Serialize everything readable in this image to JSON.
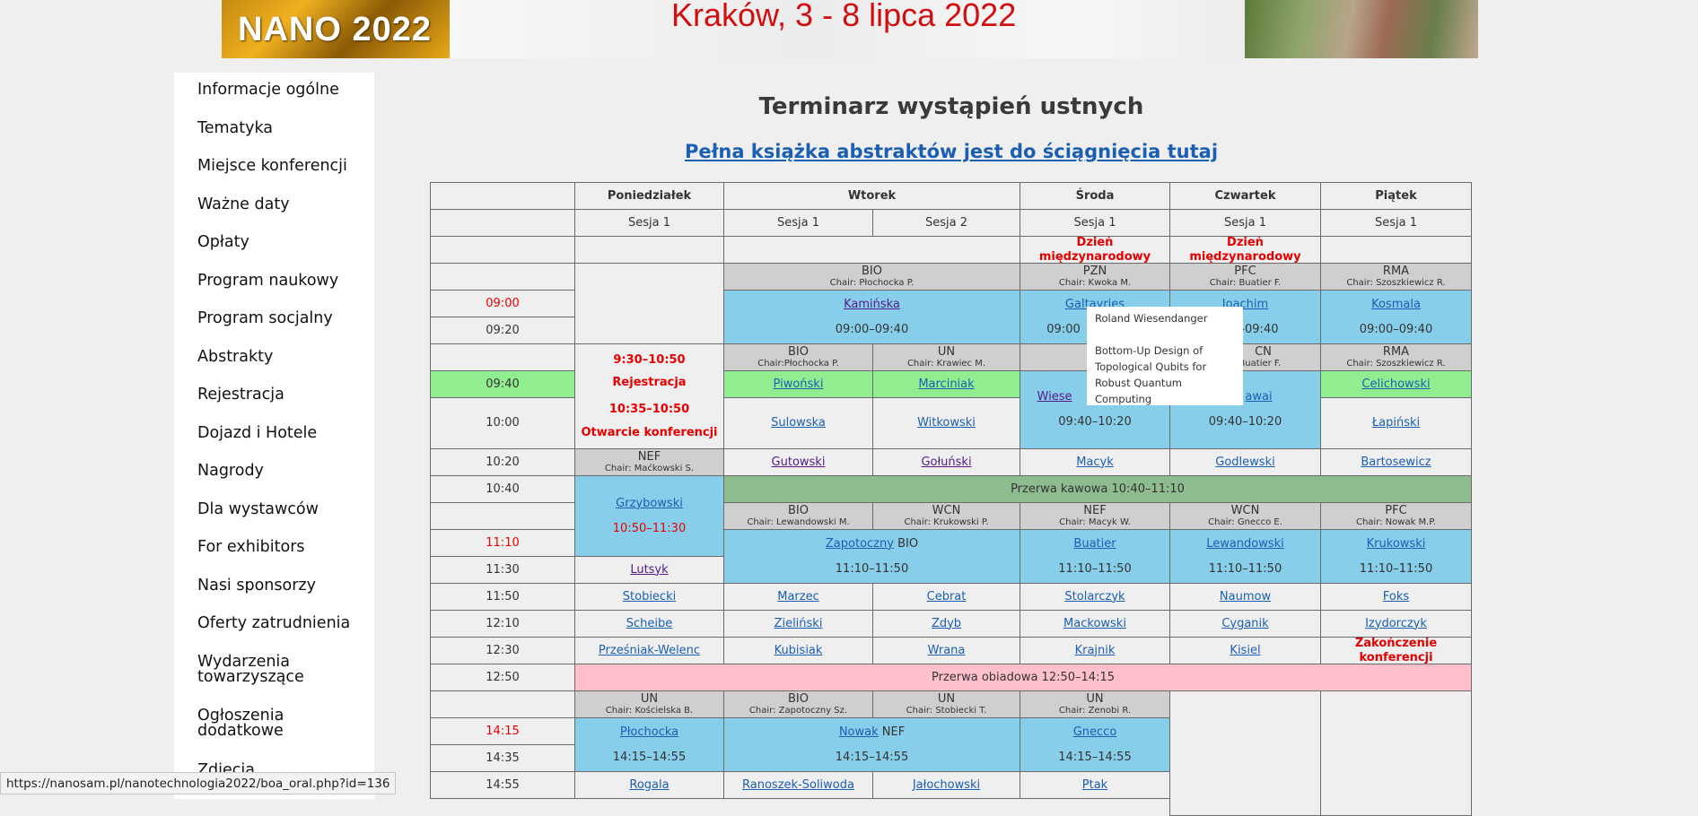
{
  "banner": {
    "logo_text": "NANO 2022",
    "subtitle": "Kraków, 3 - 8 lipca 2022"
  },
  "sidebar": {
    "items": [
      {
        "label": "Informacje ogólne"
      },
      {
        "label": "Tematyka"
      },
      {
        "label": "Miejsce konferencji"
      },
      {
        "label": "Ważne daty"
      },
      {
        "label": "Opłaty"
      },
      {
        "label": "Program naukowy"
      },
      {
        "label": "Program socjalny"
      },
      {
        "label": "Abstrakty"
      },
      {
        "label": "Rejestracja"
      },
      {
        "label": "Dojazd i Hotele"
      },
      {
        "label": "Nagrody"
      },
      {
        "label": "Dla wystawców"
      },
      {
        "label": "For exhibitors"
      },
      {
        "label": "Nasi sponsorzy"
      },
      {
        "label": "Oferty zatrudnienia"
      },
      {
        "label": "Wydarzenia towarzyszące"
      },
      {
        "label": "Ogłoszenia dodatkowe"
      },
      {
        "label": "Zdjęcia"
      }
    ]
  },
  "page": {
    "title": "Terminarz wystąpień ustnych",
    "download_link": "Pełna książka abstraktów jest do ściągnięcia tutaj"
  },
  "schedule": {
    "days": [
      "Poniedziałek",
      "Wtorek",
      "Środa",
      "Czwartek",
      "Piątek"
    ],
    "session_label": "Sesja 1",
    "session2_label": "Sesja 2",
    "intl_day": "Dzień międzynarodowy",
    "times": [
      "09:00",
      "09:20",
      "09:40",
      "10:00",
      "10:20",
      "10:40",
      "11:10",
      "11:30",
      "11:50",
      "12:10",
      "12:30",
      "12:50",
      "14:15",
      "14:35",
      "14:55"
    ],
    "sessions_r1": {
      "bio": {
        "name": "BIO",
        "chair": "Chair: Płochocka P."
      },
      "pzn": {
        "name": "PZN",
        "chair": "Chair: Kwoka M."
      },
      "pfc": {
        "name": "PFC",
        "chair": "Chair: Buatier F."
      },
      "rma": {
        "name": "RMA",
        "chair": "Chair: Szoszkiewicz R."
      }
    },
    "block1": {
      "kaminska": "Kamińska",
      "kaminska_time": "09:00–09:40",
      "galtayries": "Galtayries",
      "galtayries_time": "09:00",
      "joachim": "Joachim",
      "joachim_time": "–09:40",
      "kosmala": "Kosmala",
      "kosmala_time": "09:00–09:40"
    },
    "mon": {
      "reg_time": "9:30–10:50",
      "reg_label": "Rejestracja",
      "open_time": "10:35–10:50",
      "open_label": "Otwarcie konferencji",
      "nef": {
        "name": "NEF",
        "chair": "Chair: Maćkowski S."
      },
      "grzybowski": "Grzybowski",
      "grzybowski_time": "10:50–11:30",
      "lutsyk": "Lutsyk"
    },
    "sessions_r2": {
      "bio": {
        "name": "BIO",
        "chair": "Chair:Płochocka P."
      },
      "un": {
        "name": "UN",
        "chair": "Chair: Krawiec M."
      },
      "wed": {
        "name": "N",
        "chair": ""
      },
      "thu": {
        "name": "CN",
        "chair": "Chair: Buatier F."
      },
      "rma": {
        "name": "RMA",
        "chair": "Chair: Szoszkiewicz R."
      }
    },
    "block2": {
      "piwonski": "Piwoński",
      "marciniak": "Marciniak",
      "celichowski": "Celichowski",
      "sulowska": "Sulowska",
      "witkowski": "Witkowski",
      "lapinski": "Łapiński",
      "wiese": "Wiese",
      "wed_time": "09:40–10:20",
      "awai": "awai",
      "thu_time": "09:40–10:20",
      "gutowski": "Gutowski",
      "golunski": "Gołuński",
      "macyk": "Macyk",
      "godlewski": "Godlewski",
      "bartosewicz": "Bartosewicz"
    },
    "coffee": "Przerwa kawowa 10:40–11:10",
    "sessions_r3": {
      "bio": {
        "name": "BIO",
        "chair": "Chair: Lewandowski M."
      },
      "wcn": {
        "name": "WCN",
        "chair": "Chair: Krukowski P."
      },
      "nef": {
        "name": "NEF",
        "chair": "Chair: Macyk W."
      },
      "wcn2": {
        "name": "WCN",
        "chair": "Chair: Gnecco E."
      },
      "pfc": {
        "name": "PFC",
        "chair": "Chair: Nowak M.P."
      }
    },
    "block3": {
      "zapotoczny": "Zapotoczny",
      "zapotoczny_tag": " BIO",
      "tue_time": "11:10–11:50",
      "buatier": "Buatier",
      "wed_time": "11:10–11:50",
      "lewandowski": "Lewandowski",
      "thu_time": "11:10–11:50",
      "krukowski": "Krukowski",
      "fri_time": "11:10–11:50"
    },
    "rows_1150_1230": [
      [
        "Stobiecki",
        "Marzec",
        "Cebrat",
        "Stolarczyk",
        "Naumow",
        "Foks"
      ],
      [
        "Scheibe",
        "Zieliński",
        "Zdyb",
        "Mackowski",
        "Cyganik",
        "Izydorczyk"
      ],
      [
        "Prześniak-Welenc",
        "Kubisiak",
        "Wrana",
        "Krajnik",
        "Kisiel"
      ]
    ],
    "conf_end": "Zakończenie konferencji",
    "lunch": "Przerwa obiadowa 12:50–14:15",
    "sessions_r4": {
      "mon": {
        "name": "UN",
        "chair": "Chair: Kościelska B."
      },
      "bio": {
        "name": "BIO",
        "chair": "Chair: Zapotoczny Sz."
      },
      "un": {
        "name": "UN",
        "chair": "Chair: Stobiecki T."
      },
      "wed": {
        "name": "UN",
        "chair": "Chair: Zenobi R."
      }
    },
    "block4": {
      "plochocka": "Płochocka",
      "mon_time": "14:15–14:55",
      "nowak": "Nowak",
      "nowak_tag": " NEF",
      "tue_time": "14:15–14:55",
      "gnecco": "Gnecco",
      "wed_time": "14:15–14:55"
    },
    "row_1455": [
      "Rogala",
      "Ranoszek-Soliwoda",
      "Jałochowski",
      "Ptak"
    ]
  },
  "tooltip": {
    "author": "Roland Wiesendanger",
    "title": "Bottom-Up Design of Topological Qubits for Robust Quantum Computing"
  },
  "status_url": "https://nanosam.pl/nanotechnologia2022/boa_oral.php?id=136",
  "colors": {
    "session_blue": "#87ceeb",
    "green": "#90ee90",
    "coffee": "#8fbc8f",
    "lunch": "#ffc0cb",
    "red": "#e60000",
    "link": "#1a5fb4"
  }
}
